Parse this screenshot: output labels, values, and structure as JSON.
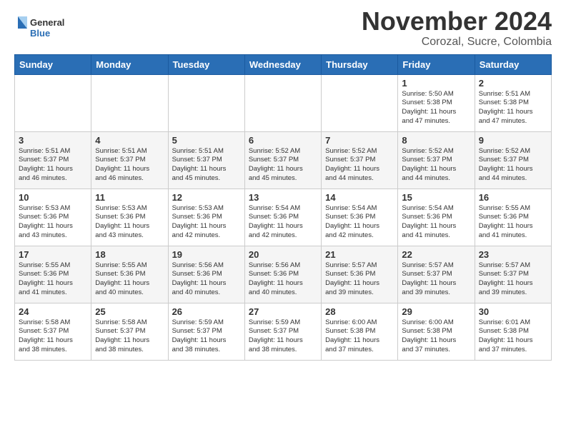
{
  "header": {
    "logo_general": "General",
    "logo_blue": "Blue",
    "title": "November 2024",
    "subtitle": "Corozal, Sucre, Colombia"
  },
  "weekdays": [
    "Sunday",
    "Monday",
    "Tuesday",
    "Wednesday",
    "Thursday",
    "Friday",
    "Saturday"
  ],
  "weeks": [
    [
      {
        "day": "",
        "info": ""
      },
      {
        "day": "",
        "info": ""
      },
      {
        "day": "",
        "info": ""
      },
      {
        "day": "",
        "info": ""
      },
      {
        "day": "",
        "info": ""
      },
      {
        "day": "1",
        "info": "Sunrise: 5:50 AM\nSunset: 5:38 PM\nDaylight: 11 hours\nand 47 minutes."
      },
      {
        "day": "2",
        "info": "Sunrise: 5:51 AM\nSunset: 5:38 PM\nDaylight: 11 hours\nand 47 minutes."
      }
    ],
    [
      {
        "day": "3",
        "info": "Sunrise: 5:51 AM\nSunset: 5:37 PM\nDaylight: 11 hours\nand 46 minutes."
      },
      {
        "day": "4",
        "info": "Sunrise: 5:51 AM\nSunset: 5:37 PM\nDaylight: 11 hours\nand 46 minutes."
      },
      {
        "day": "5",
        "info": "Sunrise: 5:51 AM\nSunset: 5:37 PM\nDaylight: 11 hours\nand 45 minutes."
      },
      {
        "day": "6",
        "info": "Sunrise: 5:52 AM\nSunset: 5:37 PM\nDaylight: 11 hours\nand 45 minutes."
      },
      {
        "day": "7",
        "info": "Sunrise: 5:52 AM\nSunset: 5:37 PM\nDaylight: 11 hours\nand 44 minutes."
      },
      {
        "day": "8",
        "info": "Sunrise: 5:52 AM\nSunset: 5:37 PM\nDaylight: 11 hours\nand 44 minutes."
      },
      {
        "day": "9",
        "info": "Sunrise: 5:52 AM\nSunset: 5:37 PM\nDaylight: 11 hours\nand 44 minutes."
      }
    ],
    [
      {
        "day": "10",
        "info": "Sunrise: 5:53 AM\nSunset: 5:36 PM\nDaylight: 11 hours\nand 43 minutes."
      },
      {
        "day": "11",
        "info": "Sunrise: 5:53 AM\nSunset: 5:36 PM\nDaylight: 11 hours\nand 43 minutes."
      },
      {
        "day": "12",
        "info": "Sunrise: 5:53 AM\nSunset: 5:36 PM\nDaylight: 11 hours\nand 42 minutes."
      },
      {
        "day": "13",
        "info": "Sunrise: 5:54 AM\nSunset: 5:36 PM\nDaylight: 11 hours\nand 42 minutes."
      },
      {
        "day": "14",
        "info": "Sunrise: 5:54 AM\nSunset: 5:36 PM\nDaylight: 11 hours\nand 42 minutes."
      },
      {
        "day": "15",
        "info": "Sunrise: 5:54 AM\nSunset: 5:36 PM\nDaylight: 11 hours\nand 41 minutes."
      },
      {
        "day": "16",
        "info": "Sunrise: 5:55 AM\nSunset: 5:36 PM\nDaylight: 11 hours\nand 41 minutes."
      }
    ],
    [
      {
        "day": "17",
        "info": "Sunrise: 5:55 AM\nSunset: 5:36 PM\nDaylight: 11 hours\nand 41 minutes."
      },
      {
        "day": "18",
        "info": "Sunrise: 5:55 AM\nSunset: 5:36 PM\nDaylight: 11 hours\nand 40 minutes."
      },
      {
        "day": "19",
        "info": "Sunrise: 5:56 AM\nSunset: 5:36 PM\nDaylight: 11 hours\nand 40 minutes."
      },
      {
        "day": "20",
        "info": "Sunrise: 5:56 AM\nSunset: 5:36 PM\nDaylight: 11 hours\nand 40 minutes."
      },
      {
        "day": "21",
        "info": "Sunrise: 5:57 AM\nSunset: 5:36 PM\nDaylight: 11 hours\nand 39 minutes."
      },
      {
        "day": "22",
        "info": "Sunrise: 5:57 AM\nSunset: 5:37 PM\nDaylight: 11 hours\nand 39 minutes."
      },
      {
        "day": "23",
        "info": "Sunrise: 5:57 AM\nSunset: 5:37 PM\nDaylight: 11 hours\nand 39 minutes."
      }
    ],
    [
      {
        "day": "24",
        "info": "Sunrise: 5:58 AM\nSunset: 5:37 PM\nDaylight: 11 hours\nand 38 minutes."
      },
      {
        "day": "25",
        "info": "Sunrise: 5:58 AM\nSunset: 5:37 PM\nDaylight: 11 hours\nand 38 minutes."
      },
      {
        "day": "26",
        "info": "Sunrise: 5:59 AM\nSunset: 5:37 PM\nDaylight: 11 hours\nand 38 minutes."
      },
      {
        "day": "27",
        "info": "Sunrise: 5:59 AM\nSunset: 5:37 PM\nDaylight: 11 hours\nand 38 minutes."
      },
      {
        "day": "28",
        "info": "Sunrise: 6:00 AM\nSunset: 5:38 PM\nDaylight: 11 hours\nand 37 minutes."
      },
      {
        "day": "29",
        "info": "Sunrise: 6:00 AM\nSunset: 5:38 PM\nDaylight: 11 hours\nand 37 minutes."
      },
      {
        "day": "30",
        "info": "Sunrise: 6:01 AM\nSunset: 5:38 PM\nDaylight: 11 hours\nand 37 minutes."
      }
    ]
  ]
}
